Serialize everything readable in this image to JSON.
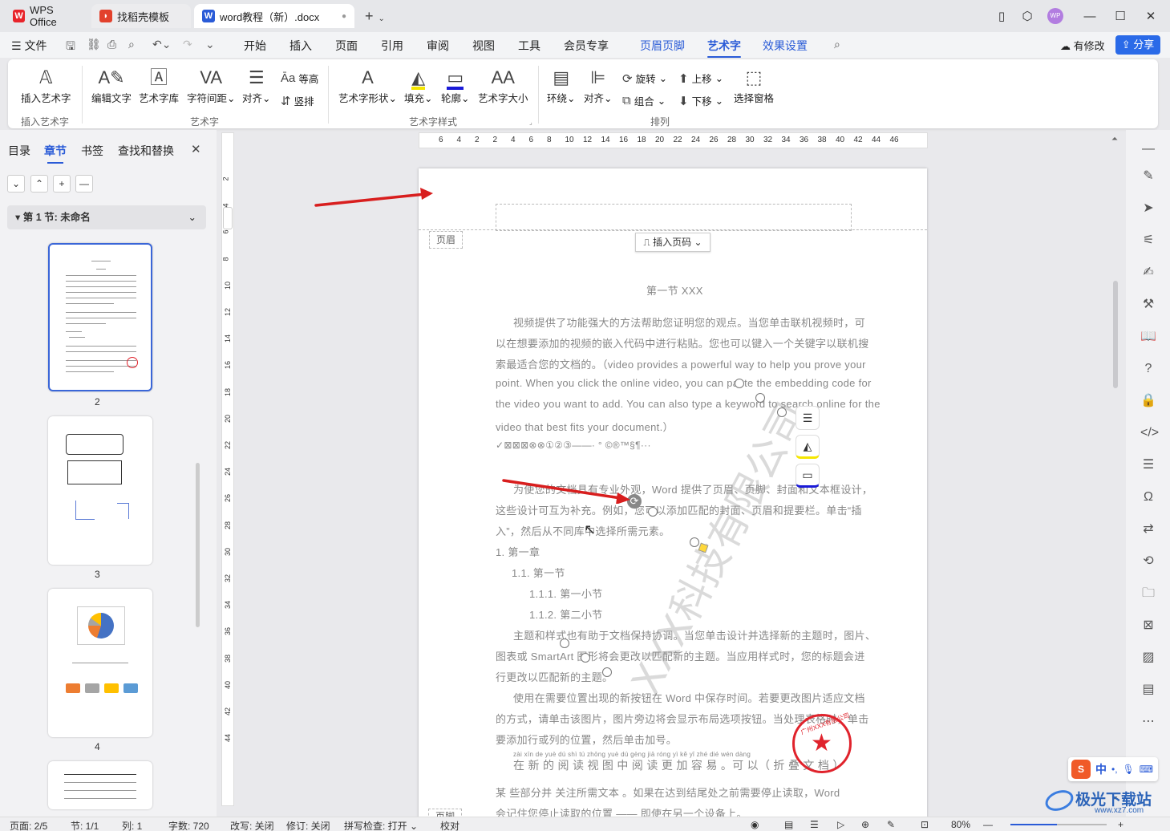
{
  "titlebar": {
    "tabs": [
      {
        "label": "WPS Office",
        "icon": "wps-logo-icon"
      },
      {
        "label": "找稻壳模板",
        "icon": "docer-icon"
      },
      {
        "label": "word教程（新）.docx",
        "icon": "word-doc-icon"
      }
    ],
    "new_tab": "+",
    "user_initials": "WP"
  },
  "menubar": {
    "file": "文件",
    "items": [
      "开始",
      "插入",
      "页面",
      "引用",
      "审阅",
      "视图",
      "工具",
      "会员专享",
      "页眉页脚",
      "艺术字",
      "效果设置"
    ],
    "active": "艺术字",
    "revise": "有修改",
    "share": "分享"
  },
  "ribbon": {
    "insert_art": "插入艺术字",
    "edit_text": "编辑文字",
    "art_lib": "艺术字库",
    "char_spacing": "字符间距",
    "align": "对齐",
    "equal_height": "等高",
    "vertical": "竖排",
    "art_shape": "艺术字形状",
    "fill": "填充",
    "outline": "轮廓",
    "art_size": "艺术字大小",
    "wrap": "环绕",
    "align2": "对齐",
    "rotate": "旋转",
    "group": "组合",
    "bring_up": "上移",
    "send_down": "下移",
    "select_pane": "选择窗格",
    "groups": [
      "插入艺术字",
      "艺术字",
      "艺术字样式",
      "排列"
    ]
  },
  "leftpanel": {
    "tabs": [
      "目录",
      "章节",
      "书签",
      "查找和替换"
    ],
    "active": "章节",
    "section": "第 1 节: 未命名",
    "pages": [
      "2",
      "3",
      "4"
    ]
  },
  "ruler": {
    "top": [
      "6",
      "4",
      "2",
      "2",
      "4",
      "6",
      "8",
      "10",
      "12",
      "14",
      "16",
      "18",
      "20",
      "22",
      "24",
      "26",
      "28",
      "30",
      "32",
      "34",
      "36",
      "38",
      "40",
      "42",
      "44",
      "46"
    ],
    "left": [
      "2",
      "4",
      "6",
      "8",
      "10",
      "12",
      "14",
      "16",
      "18",
      "20",
      "22",
      "24",
      "26",
      "28",
      "30",
      "32",
      "34",
      "36",
      "38",
      "40",
      "42",
      "44"
    ]
  },
  "document": {
    "header_label": "页眉",
    "footer_label": "页脚",
    "insert_page_num": "插入页码",
    "heading": "第一节  XXX",
    "p1": [
      "视频提供了功能强大的方法帮助您证明您的观点。当您单击联机视频时，可",
      "以在想要添加的视频的嵌入代码中进行粘贴。您也可以键入一个关键字以联机搜",
      "索最适合您的文档的。（video provides a powerful way to help you prove your",
      "point. When you click the online video, you can paste the embedding code for",
      "the video you want to add. You can also type a keyword to search online for the",
      "video that best fits your document.）"
    ],
    "symbols": "✓⊠⊠⊠⊗⊗①②③——·  °  ©®™§¶···",
    "p2": [
      "为使您的文档具有专业外观，Word 提供了页眉、页脚、封面和文本框设计，",
      "这些设计可互为补充。例如，您可以添加匹配的封面、页眉和提要栏。单击“插",
      "入”，然后从不同库中选择所需元素。"
    ],
    "list": [
      "1.    第一章",
      "1.1.  第一节",
      "1.1.1.   第一小节",
      "1.1.2.   第二小节"
    ],
    "p3": [
      "主题和样式也有助于文档保持协调。当您单击设计并选择新的主题时，图片、",
      "图表或 SmartArt 图形将会更改以匹配新的主题。当应用样式时，您的标题会进",
      "行更改以匹配新的主题。"
    ],
    "p4": [
      "使用在需要位置出现的新按钮在 Word 中保存时间。若要更改图片适应文档",
      "的方式，请单击该图片，图片旁边将会显示布局选项按钮。当处理表格时，单击",
      "要添加行或列的位置，然后单击加号。"
    ],
    "pinyin_line": "在 新 的 阅 读 视 图 中 阅 读 更 加 容 易 。可 以（ 折 叠 文 档 ）",
    "pinyin_small": "zài xīn de yuè dú shì tú zhōng yuè dú gèng jiā róng yì    kě yǐ      zhé dié wén dàng",
    "p5": "某 些部分并 关注所需文本 。如果在达到结尾处之前需要停止读取，Word",
    "p5b": "会记住您停止读取的位置 —— 即使在另一个设备上。",
    "watermark": "XXX科技有限公司",
    "seal_text": "广州XXX有限公司"
  },
  "statusbar": {
    "page": "页面: 2/5",
    "section": "节: 1/1",
    "col": "列: 1",
    "words": "字数: 720",
    "track": "改写: 关闭",
    "revise": "修订: 关闭",
    "spell": "拼写检查: 打开",
    "proof": "校对",
    "zoom": "80%"
  },
  "ime": {
    "label": "中",
    "brand": "极光下载站",
    "url": "www.xz7.com"
  },
  "colors": {
    "accent": "#2a5bd7",
    "arrow": "#d81e1e",
    "seal": "#e0232c"
  }
}
